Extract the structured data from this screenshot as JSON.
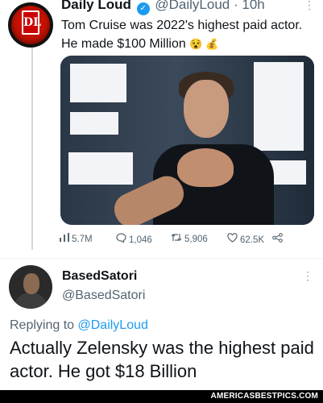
{
  "tweet": {
    "author_name": "Daily Loud",
    "author_handle": "@DailyLoud",
    "time": "· 10h",
    "text": "Tom Cruise was 2022's highest paid actor. He made $100 Million",
    "emojis": "😵 💰",
    "avatar_text": "DL",
    "stats": {
      "views": "5.7M",
      "replies": "1,046",
      "retweets": "5,906",
      "likes": "62.5K"
    }
  },
  "reply": {
    "author_name": "BasedSatori",
    "author_handle": "@BasedSatori",
    "replying_prefix": "Replying to ",
    "replying_to": "@DailyLoud",
    "text": "Actually Zelensky was the highest paid actor. He got $18 Billion"
  },
  "watermark": "AMERICASBESTPICS.COM",
  "icons": [
    "verified-icon",
    "more-icon",
    "views-icon",
    "reply-icon",
    "retweet-icon",
    "like-icon",
    "share-icon"
  ],
  "colors": {
    "accent": "#1d9bf0",
    "muted": "#536471",
    "text": "#0f1419"
  }
}
